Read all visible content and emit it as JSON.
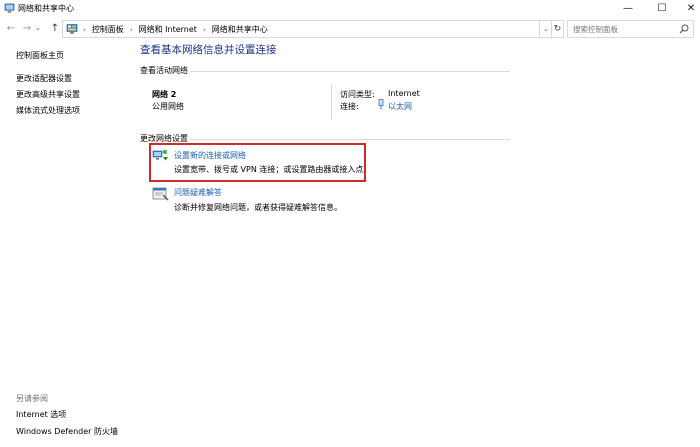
{
  "window": {
    "title": "网络和共享中心",
    "controls": {
      "minimize": "—",
      "maximize": "☐",
      "close": "✕"
    }
  },
  "address_bar": {
    "breadcrumbs": [
      "控制面板",
      "网络和 Internet",
      "网络和共享中心"
    ],
    "separator": "›"
  },
  "search": {
    "placeholder": "搜索控制面板"
  },
  "sidebar": {
    "items": [
      {
        "label": "控制面板主页"
      },
      {
        "label": "更改适配器设置"
      },
      {
        "label": "更改高级共享设置"
      },
      {
        "label": "媒体流式处理选项"
      }
    ],
    "see_also_title": "另请参阅",
    "see_also": [
      {
        "label": "Internet 选项"
      },
      {
        "label": "Windows Defender 防火墙"
      }
    ]
  },
  "main": {
    "title": "查看基本网络信息并设置连接",
    "active_networks_heading": "查看活动网络",
    "network": {
      "name": "网络 2",
      "category": "公用网络",
      "access_type_label": "访问类型:",
      "access_type_value": "Internet",
      "connections_label": "连接:",
      "connections_value": "以太网"
    },
    "change_settings_heading": "更改网络设置",
    "tasks": [
      {
        "link": "设置新的连接或网络",
        "description": "设置宽带、拨号或 VPN 连接；或设置路由器或接入点。",
        "icon": "network-setup-icon"
      },
      {
        "link": "问题疑难解答",
        "description": "诊断并修复网络问题，或者获得疑难解答信息。",
        "icon": "troubleshoot-icon"
      }
    ]
  },
  "colors": {
    "title_blue": "#1e3287",
    "link_blue": "#1a5fb4",
    "highlight_red": "#d22a2a"
  }
}
